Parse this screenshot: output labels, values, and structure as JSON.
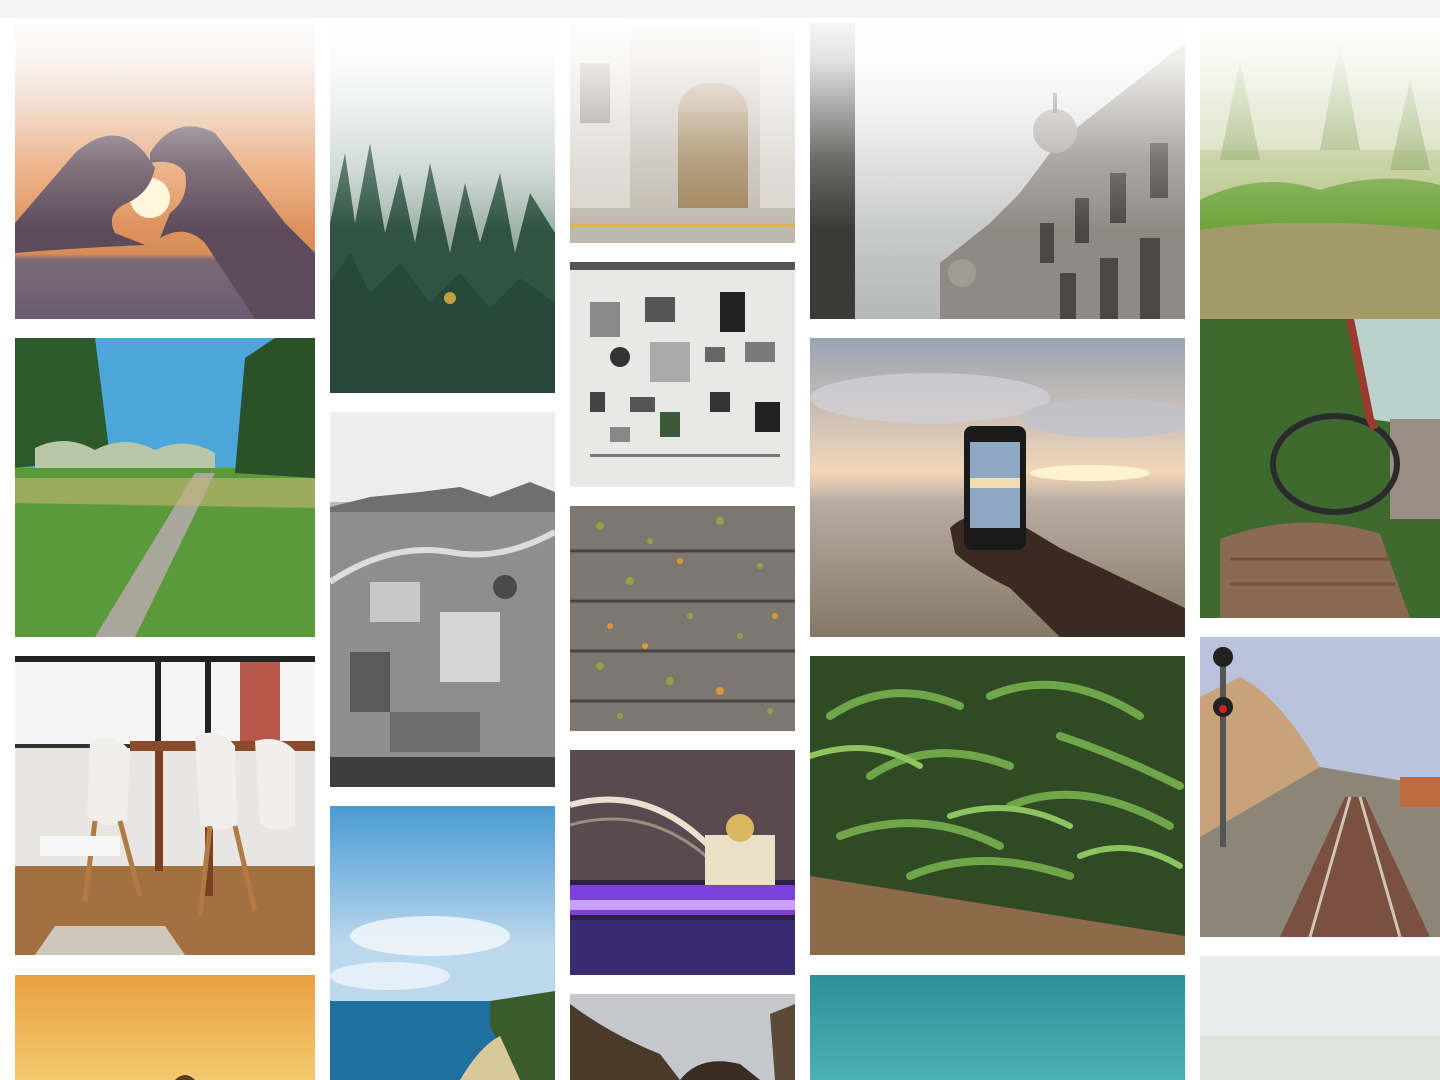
{
  "gallery": {
    "photos": [
      {
        "id": "p1",
        "subject": "heart-hands-sunset-photo"
      },
      {
        "id": "p2",
        "subject": "misty-pine-forest-photo"
      },
      {
        "id": "p3",
        "subject": "old-wooden-door-photo"
      },
      {
        "id": "p4",
        "subject": "baroque-building-facade-photo"
      },
      {
        "id": "p5",
        "subject": "mossy-forest-floor-photo"
      },
      {
        "id": "p6",
        "subject": "grass-path-trees-photo"
      },
      {
        "id": "p7",
        "subject": "black-white-city-aerial-photo"
      },
      {
        "id": "p8",
        "subject": "disassembled-camera-parts-photo"
      },
      {
        "id": "p9",
        "subject": "phone-photographing-sunset-sea-photo"
      },
      {
        "id": "p10",
        "subject": "abandoned-car-interior-photo"
      },
      {
        "id": "p11",
        "subject": "wooden-deck-leaves-photo"
      },
      {
        "id": "p12",
        "subject": "dining-room-chairs-photo"
      },
      {
        "id": "p13",
        "subject": "green-beans-photo"
      },
      {
        "id": "p14",
        "subject": "railway-tracks-coast-photo"
      },
      {
        "id": "p15",
        "subject": "bridge-cathedral-night-photo"
      },
      {
        "id": "p16",
        "subject": "coastline-sea-sky-photo"
      },
      {
        "id": "p17",
        "subject": "orange-sunset-sky-photo"
      },
      {
        "id": "p18",
        "subject": "eagle-wings-photo"
      },
      {
        "id": "p19",
        "subject": "turquoise-water-photo"
      },
      {
        "id": "p20",
        "subject": "pale-sky-photo"
      }
    ]
  },
  "colors": {
    "background": "#ffffff",
    "fade": "#ffffff"
  }
}
